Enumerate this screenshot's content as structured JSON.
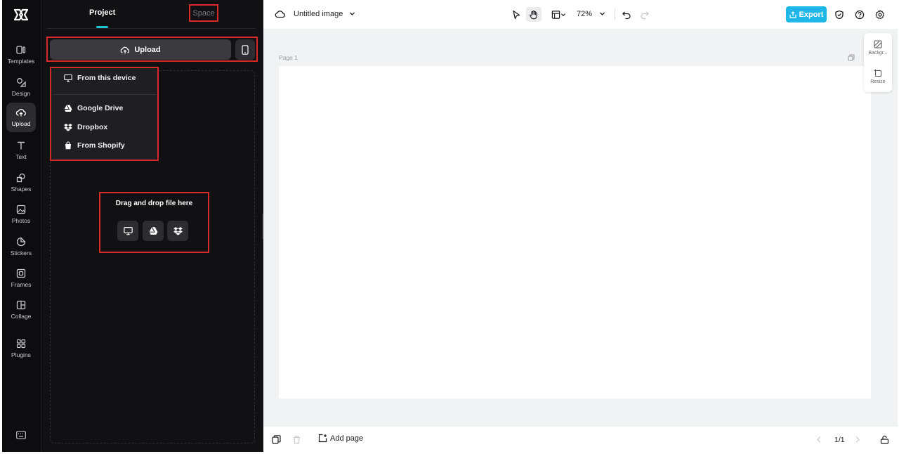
{
  "rail": {
    "items": [
      {
        "label": "Templates",
        "icon": "templates-icon"
      },
      {
        "label": "Design",
        "icon": "design-icon"
      },
      {
        "label": "Upload",
        "icon": "upload-icon",
        "active": true
      },
      {
        "label": "Text",
        "icon": "text-icon"
      },
      {
        "label": "Shapes",
        "icon": "shapes-icon"
      },
      {
        "label": "Photos",
        "icon": "photos-icon"
      },
      {
        "label": "Stickers",
        "icon": "stickers-icon"
      },
      {
        "label": "Frames",
        "icon": "frames-icon"
      },
      {
        "label": "Collage",
        "icon": "collage-icon"
      },
      {
        "label": "Plugins",
        "icon": "plugins-icon"
      }
    ]
  },
  "panel": {
    "tabs": [
      {
        "label": "Project",
        "active": true
      },
      {
        "label": "Space",
        "active": false
      }
    ],
    "upload_label": "Upload",
    "menu": [
      {
        "label": "From this device",
        "icon": "monitor-icon"
      },
      {
        "label": "Google Drive",
        "icon": "google-drive-icon"
      },
      {
        "label": "Dropbox",
        "icon": "dropbox-icon"
      },
      {
        "label": "From Shopify",
        "icon": "shopify-icon"
      }
    ],
    "drag_text": "Drag and drop file here"
  },
  "topbar": {
    "doc_title": "Untitled image",
    "zoom": "72%",
    "export_label": "Export"
  },
  "canvas": {
    "page_label": "Page 1"
  },
  "side_tools": [
    {
      "label": "Backgr...",
      "icon": "background-icon"
    },
    {
      "label": "Resize",
      "icon": "resize-icon"
    }
  ],
  "bottombar": {
    "add_page_label": "Add page",
    "page_count": "1/1"
  },
  "colors": {
    "accent": "#1fb7e8",
    "tab_underline": "#20c3d8",
    "highlight_box": "#d42a2a",
    "panel_bg": "#111113"
  }
}
